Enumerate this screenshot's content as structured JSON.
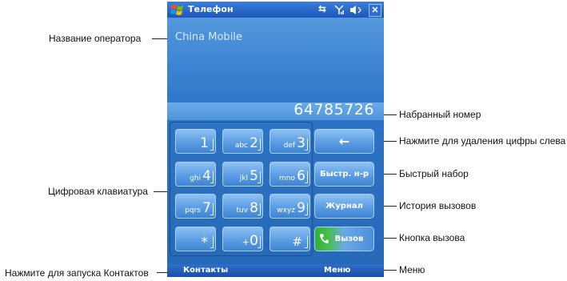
{
  "titlebar": {
    "title": "Телефон",
    "icons": [
      "windows-flag-icon",
      "connectivity-icon",
      "signal-icon",
      "volume-icon",
      "close-icon"
    ],
    "close_label": "✕"
  },
  "operator": "China Mobile",
  "dialed_number": "64785726",
  "keypad": {
    "keys": [
      {
        "digit": "1",
        "letters": ""
      },
      {
        "digit": "2",
        "letters": "abc"
      },
      {
        "digit": "3",
        "letters": "def"
      },
      {
        "digit": "4",
        "letters": "ghi"
      },
      {
        "digit": "5",
        "letters": "jkl"
      },
      {
        "digit": "6",
        "letters": "mno"
      },
      {
        "digit": "7",
        "letters": "pqrs"
      },
      {
        "digit": "8",
        "letters": "tuv"
      },
      {
        "digit": "9",
        "letters": "wxyz"
      },
      {
        "digit": "*",
        "letters": ""
      },
      {
        "digit": "0",
        "letters": "+"
      },
      {
        "digit": "#",
        "letters": ""
      }
    ]
  },
  "buttons": {
    "backspace": "←",
    "speed_dial": "Быстр. н-р",
    "call_log": "Журнал",
    "call": "Вызов"
  },
  "softkeys": {
    "left": "Контакты",
    "right": "Меню"
  },
  "callouts": {
    "operator_name": "Название оператора",
    "keypad": "Цифровая клавиатура",
    "contacts": "Нажмите для запуска Контактов",
    "dialed_number": "Набранный номер",
    "delete_digit": "Нажмите для удаления цифры слева",
    "speed_dial": "Быстрый набор",
    "call_history": "История вызовов",
    "call_button": "Кнопка вызова",
    "menu": "Меню"
  }
}
